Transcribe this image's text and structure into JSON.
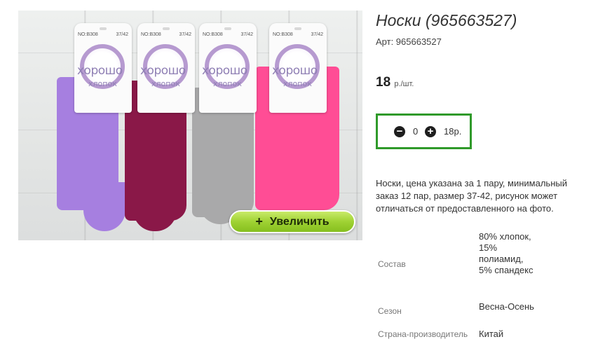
{
  "product": {
    "title": "Носки (965663527)",
    "article": "Арт: 965663527",
    "price_value": "18",
    "price_unit": "р./шт."
  },
  "image": {
    "zoom_button_icon": "+",
    "zoom_button_label": "Увеличить",
    "tag_code": "NO:B308",
    "tag_size": "37/42",
    "tag_brand_line1": "хорошо",
    "tag_brand_line2": "хлопок",
    "sock_colors": [
      "#a67fe0",
      "#8a1848",
      "#a9a9aa",
      "#ff4d95"
    ]
  },
  "quantity": {
    "minus_icon": "−",
    "value": "0",
    "plus_icon": "+",
    "sum": "18р."
  },
  "description": "Носки, цена указана за 1 пару, минимальный заказ 12 пар, размер 37-42, рисунок может отличаться от предоставленного на фото.",
  "specs": [
    {
      "label": "Состав",
      "value": "80% хлопок, 15% полиамид, 5% спандекс"
    },
    {
      "label": "Сезон",
      "value": "Весна-Осень"
    },
    {
      "label": "Страна-производитель",
      "value": "Китай"
    }
  ],
  "colors": {
    "accent_green": "#2f9a2a",
    "zoom_button_green": "#9fd233"
  }
}
